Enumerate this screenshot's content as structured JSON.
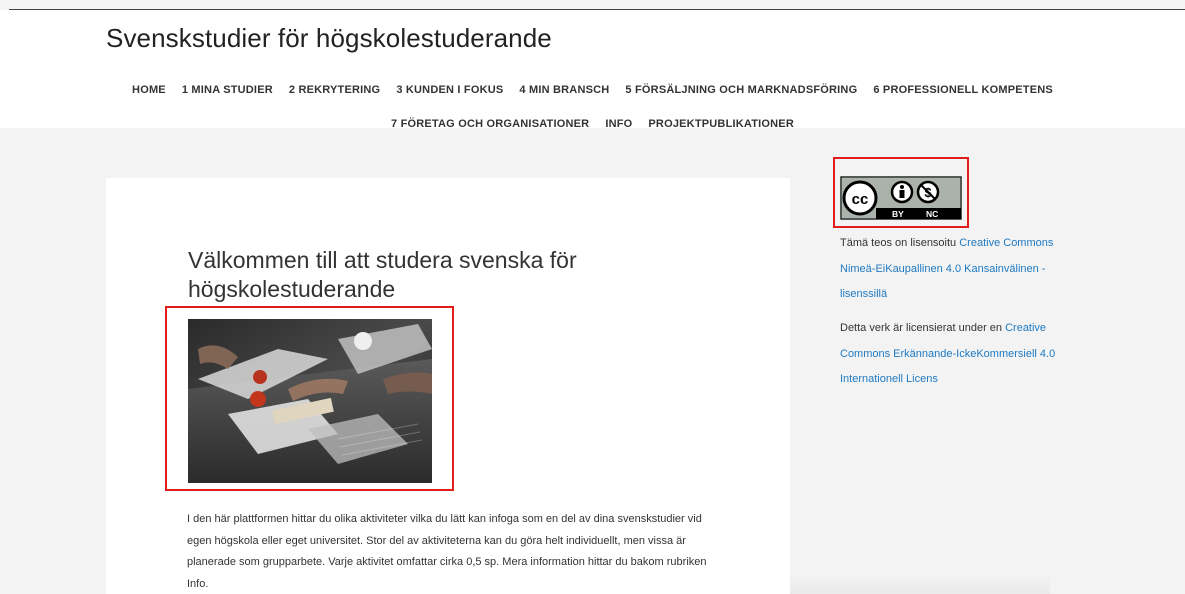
{
  "site": {
    "title": "Svenskstudier för högskolestuderande"
  },
  "nav": {
    "row1": [
      "HOME",
      "1 MINA STUDIER",
      "2 REKRYTERING",
      "3 KUNDEN I FOKUS",
      "4 MIN BRANSCH",
      "5 FÖRSÄLJNING OCH MARKNADSFÖRING",
      "6 PROFESSIONELL KOMPETENS"
    ],
    "row2": [
      "7 FÖRETAG OCH ORGANISATIONER",
      "INFO",
      "PROJEKTPUBLIKATIONER"
    ]
  },
  "article": {
    "title": "Välkommen till att studera svenska för högskolestuderande",
    "image_icon": "photo-students-working",
    "body": "I den här plattformen hittar  du olika aktiviteter vilka du lätt kan infoga som en del av dina svenskstudier vid egen högskola eller eget universitet. Stor del av aktiviteterna kan du göra helt individuellt, men vissa är planerade som grupparbete. Varje aktivitet omfattar cirka 0,5 sp. Mera information hittar du bakom rubriken Info."
  },
  "sidebar": {
    "badge_labels": {
      "by": "BY",
      "nc": "NC",
      "cc": "cc"
    },
    "license_fi": {
      "prefix": "Tämä teos on lisensoitu ",
      "link": "Creative Commons Nimeä-EiKaupallinen 4.0 Kansainvälinen -lisenssillä"
    },
    "license_sv": {
      "prefix": "Detta verk är licensierat under en ",
      "link": "Creative Commons Erkännande-IckeKommersiell 4.0 Internationell Licens"
    }
  },
  "colors": {
    "highlight": "#e41b1b",
    "link": "#1f7ac2"
  }
}
